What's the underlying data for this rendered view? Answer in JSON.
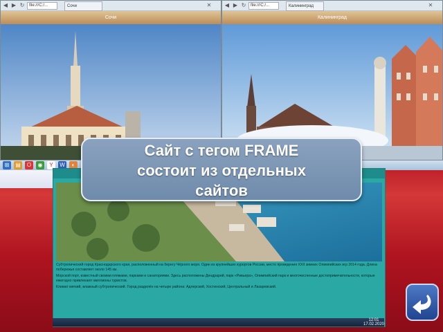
{
  "left_window": {
    "url": "file:///C:/...",
    "tab": "Сочи",
    "photo_title": "Сочи"
  },
  "right_window": {
    "url": "file:///C:/...",
    "tab": "Калининград",
    "photo_title": "Калининград"
  },
  "callout": {
    "line1": "Сайт с тегом FRAME",
    "line2": "состоит из отдельных",
    "line3": "сайтов"
  },
  "inner_page": {
    "paragraph1": "Субтропический город Краснодарского края, расположенный на берегу Чёрного моря. Один из крупнейших курортов России, место проведения XXII зимних Олимпийских игр 2014 года. Длина побережья составляет около 145 км.",
    "paragraph2": "Морской порт, известный своими пляжами, парками и санаториями. Здесь расположены Дендрарий, парк «Ривьера», Олимпийский парк и многочисленные достопримечательности, которые ежегодно привлекают миллионы туристов.",
    "paragraph3": "Климат мягкий, влажный субтропический. Город разделён на четыре района: Адлерский, Хостинский, Центральный и Лазаревский."
  },
  "clock": {
    "time": "12:01",
    "date": "17.02.2020"
  },
  "icons": [
    "back-icon",
    "forward-icon",
    "home-icon",
    "chrome-icon",
    "yandex-icon",
    "opera-icon",
    "firefox-icon",
    "folder-icon",
    "word-icon",
    "paint-icon",
    "return-arrow-icon"
  ]
}
